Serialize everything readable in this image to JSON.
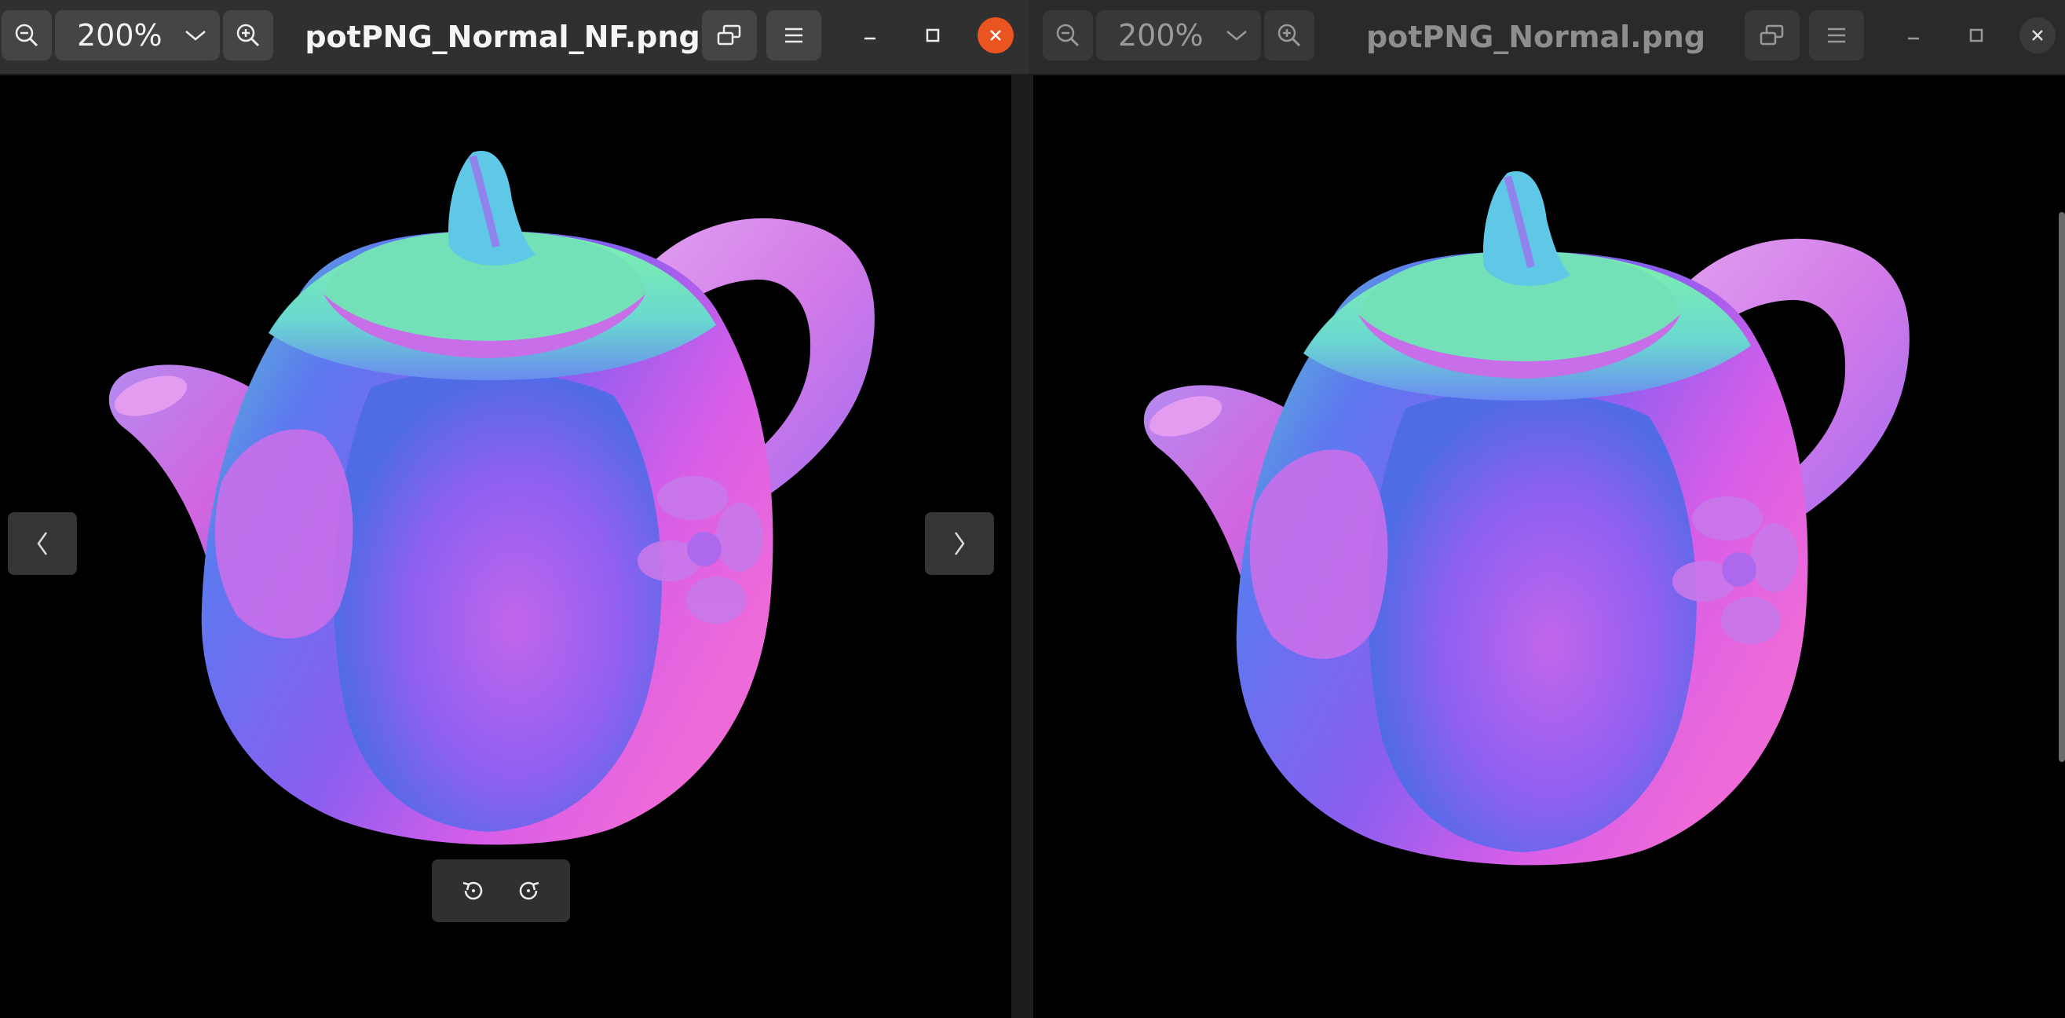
{
  "left_window": {
    "zoom": "200%",
    "title": "potPNG_Normal_NF.png",
    "image_alt": "Normal map render of a pumpkin-shaped teapot"
  },
  "right_window": {
    "zoom": "200%",
    "title": "potPNG_Normal.png",
    "image_alt": "Normal map render of a pumpkin-shaped teapot"
  },
  "icons": {
    "zoom_out": "zoom-out-icon",
    "zoom_in": "zoom-in-icon",
    "dropdown": "chevron-down-icon",
    "fit": "fit-window-icon",
    "menu": "hamburger-menu-icon",
    "minimize": "minimize-icon",
    "maximize": "maximize-icon",
    "close": "close-icon",
    "previous": "chevron-left-icon",
    "next": "chevron-right-icon",
    "rotate_left": "rotate-left-icon",
    "rotate_right": "rotate-right-icon"
  },
  "colors": {
    "close_active": "#e95420",
    "header_bg": "#303030",
    "image_bg": "#000000"
  }
}
